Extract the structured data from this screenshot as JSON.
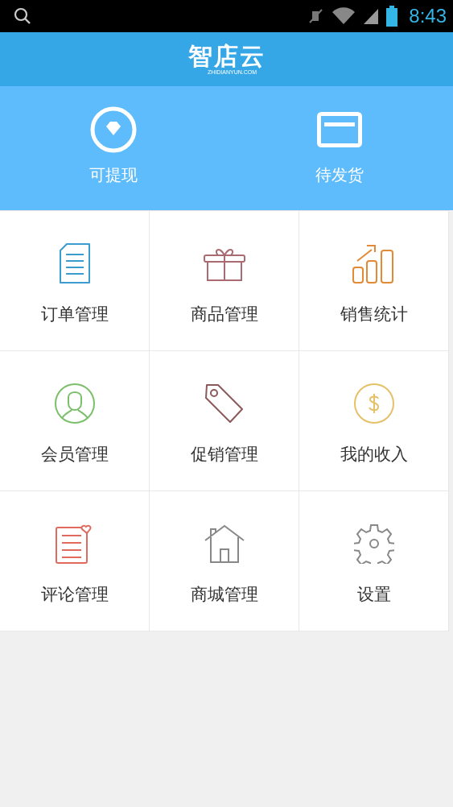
{
  "status_bar": {
    "time": "8:43"
  },
  "header": {
    "logo": "智店云",
    "logo_subtitle": "ZHIDIANYUN.COM"
  },
  "summary": [
    {
      "label": "可提现"
    },
    {
      "label": "待发货"
    }
  ],
  "menu": [
    {
      "label": "订单管理"
    },
    {
      "label": "商品管理"
    },
    {
      "label": "销售统计"
    },
    {
      "label": "会员管理"
    },
    {
      "label": "促销管理"
    },
    {
      "label": "我的收入"
    },
    {
      "label": "评论管理"
    },
    {
      "label": "商城管理"
    },
    {
      "label": "设置"
    }
  ]
}
